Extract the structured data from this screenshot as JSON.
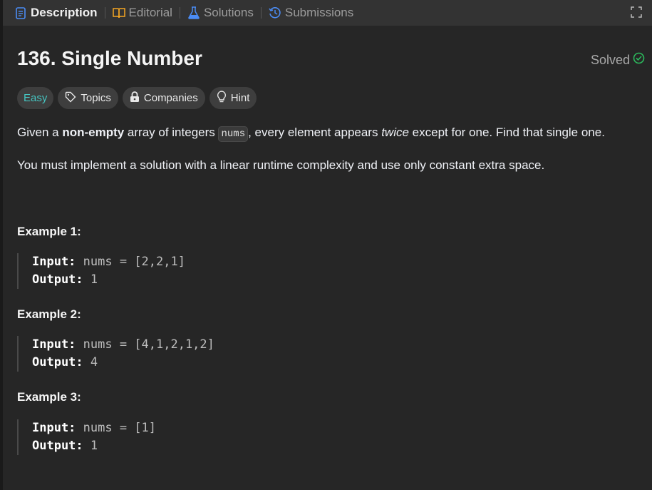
{
  "tabs": [
    {
      "label": "Description",
      "icon": "description-icon",
      "color": "#4b8cf5"
    },
    {
      "label": "Editorial",
      "icon": "book-icon",
      "color": "#f5a623"
    },
    {
      "label": "Solutions",
      "icon": "flask-icon",
      "color": "#4b8cf5"
    },
    {
      "label": "Submissions",
      "icon": "history-icon",
      "color": "#4b8cf5"
    }
  ],
  "problem": {
    "title": "136. Single Number",
    "status": "Solved",
    "tags": {
      "difficulty": "Easy",
      "topics": "Topics",
      "companies": "Companies",
      "hint": "Hint"
    },
    "desc": {
      "p1_a": "Given a ",
      "p1_b": "non-empty",
      "p1_c": " array of integers ",
      "p1_code": "nums",
      "p1_d": ", every element appears ",
      "p1_e": "twice",
      "p1_f": " except for one. Find that single one.",
      "p2": "You must implement a solution with a linear runtime complexity and use only constant extra space."
    },
    "examples": [
      {
        "title": "Example 1:",
        "input_label": "Input:",
        "input": " nums = [2,2,1]",
        "output_label": "Output:",
        "output": " 1"
      },
      {
        "title": "Example 2:",
        "input_label": "Input:",
        "input": " nums = [4,1,2,1,2]",
        "output_label": "Output:",
        "output": " 4"
      },
      {
        "title": "Example 3:",
        "input_label": "Input:",
        "input": " nums = [1]",
        "output_label": "Output:",
        "output": " 1"
      }
    ]
  },
  "colors": {
    "accent_easy": "#46c6c2",
    "solved_check": "#2cbb5d"
  }
}
